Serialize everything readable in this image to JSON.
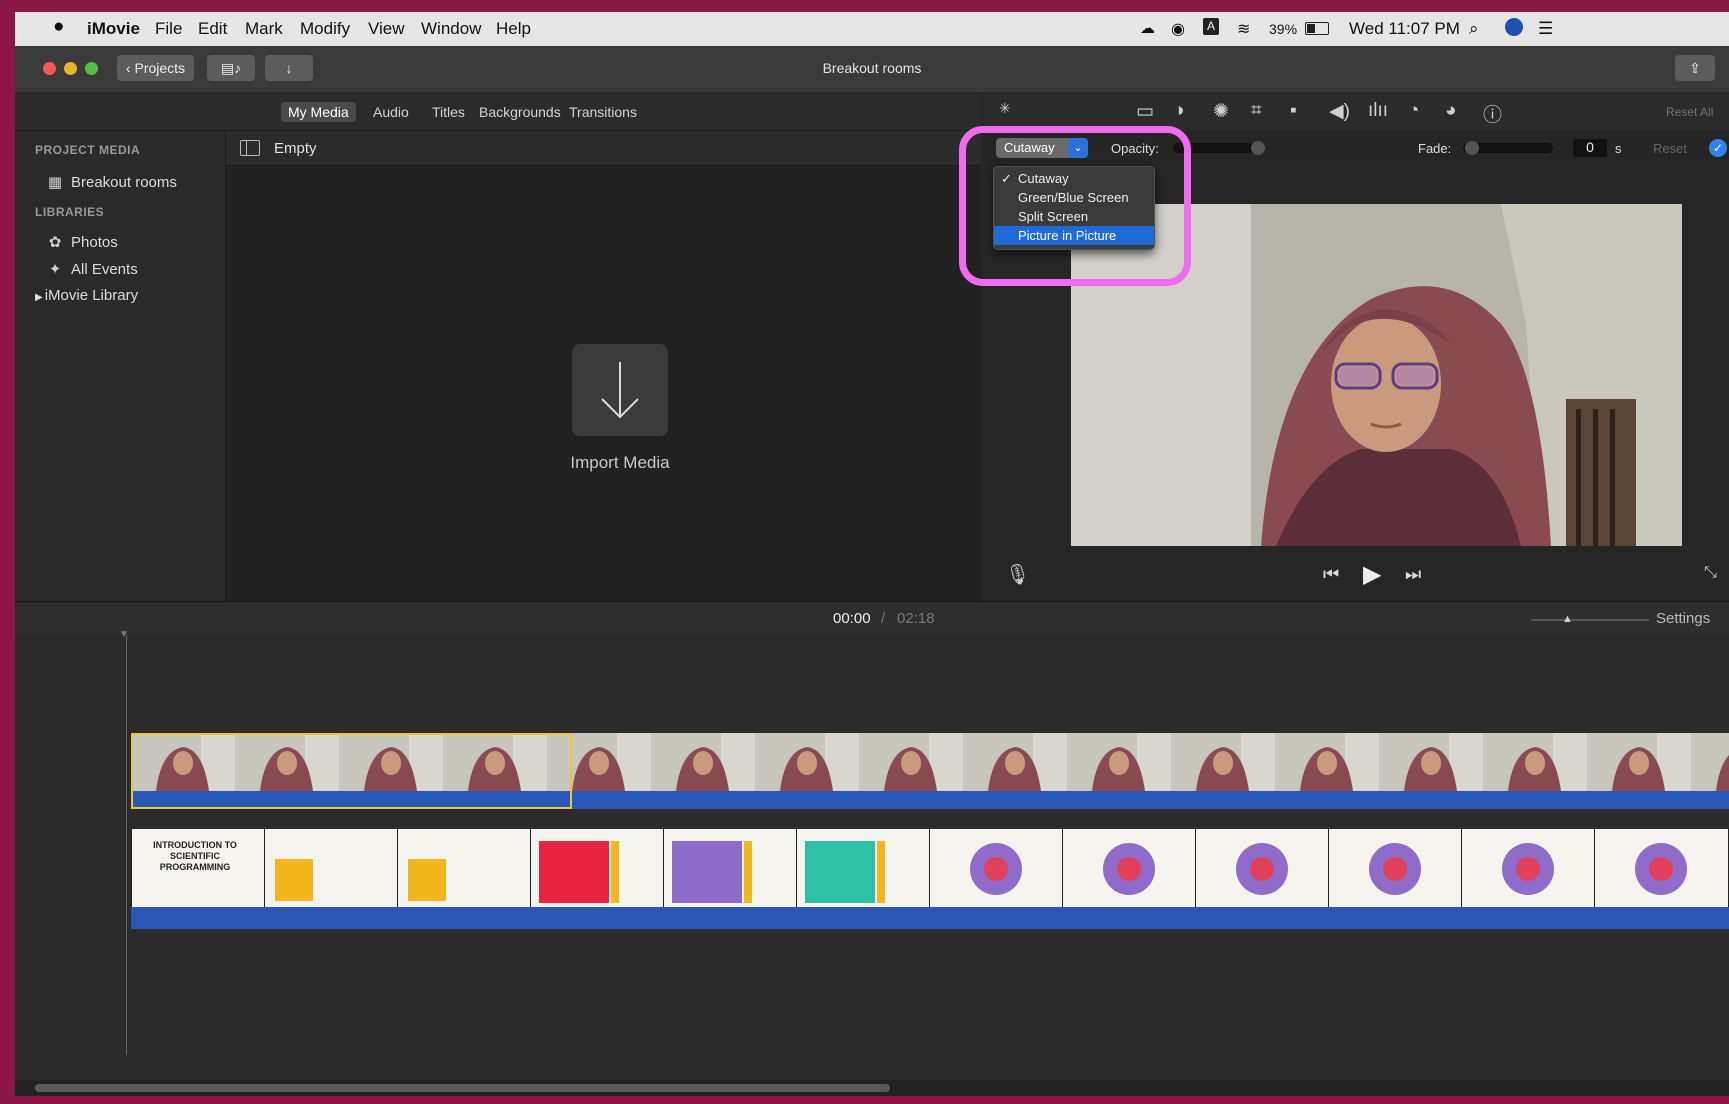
{
  "menubar": {
    "app": "iMovie",
    "items": [
      "File",
      "Edit",
      "Mark",
      "Modify",
      "View",
      "Window",
      "Help"
    ],
    "battery": "39%",
    "clock": "Wed 11:07 PM"
  },
  "window": {
    "title": "Breakout rooms",
    "projects_button": "Projects"
  },
  "media_tabs": [
    "My Media",
    "Audio",
    "Titles",
    "Backgrounds",
    "Transitions"
  ],
  "sidebar": {
    "project_media_header": "PROJECT MEDIA",
    "project_item": "Breakout rooms",
    "libraries_header": "LIBRARIES",
    "library_items": [
      "Photos",
      "All Events",
      "iMovie Library"
    ]
  },
  "media_pane": {
    "filter_label": "Empty",
    "import_label": "Import Media"
  },
  "viewer": {
    "reset_all": "Reset All",
    "overlay_mode": "Cutaway",
    "opacity_label": "Opacity:",
    "fade_label": "Fade:",
    "fade_value": "0",
    "fade_unit": "s",
    "reset_label": "Reset",
    "overlay_menu": {
      "items": [
        "Cutaway",
        "Green/Blue Screen",
        "Split Screen",
        "Picture in Picture"
      ],
      "checked": "Cutaway",
      "highlighted": "Picture in Picture"
    }
  },
  "timeline": {
    "current_time": "00:00",
    "separator": "/",
    "total_time": "02:18",
    "settings_label": "Settings",
    "first_slide_title": "INTRODUCTION TO SCIENTIFIC PROGRAMMING"
  },
  "colors": {
    "background_frame": "#8a1744",
    "highlight_outline": "#ef6cf0",
    "menu_highlight": "#1f6ad6",
    "audio_waveform": "#2a57b5"
  }
}
